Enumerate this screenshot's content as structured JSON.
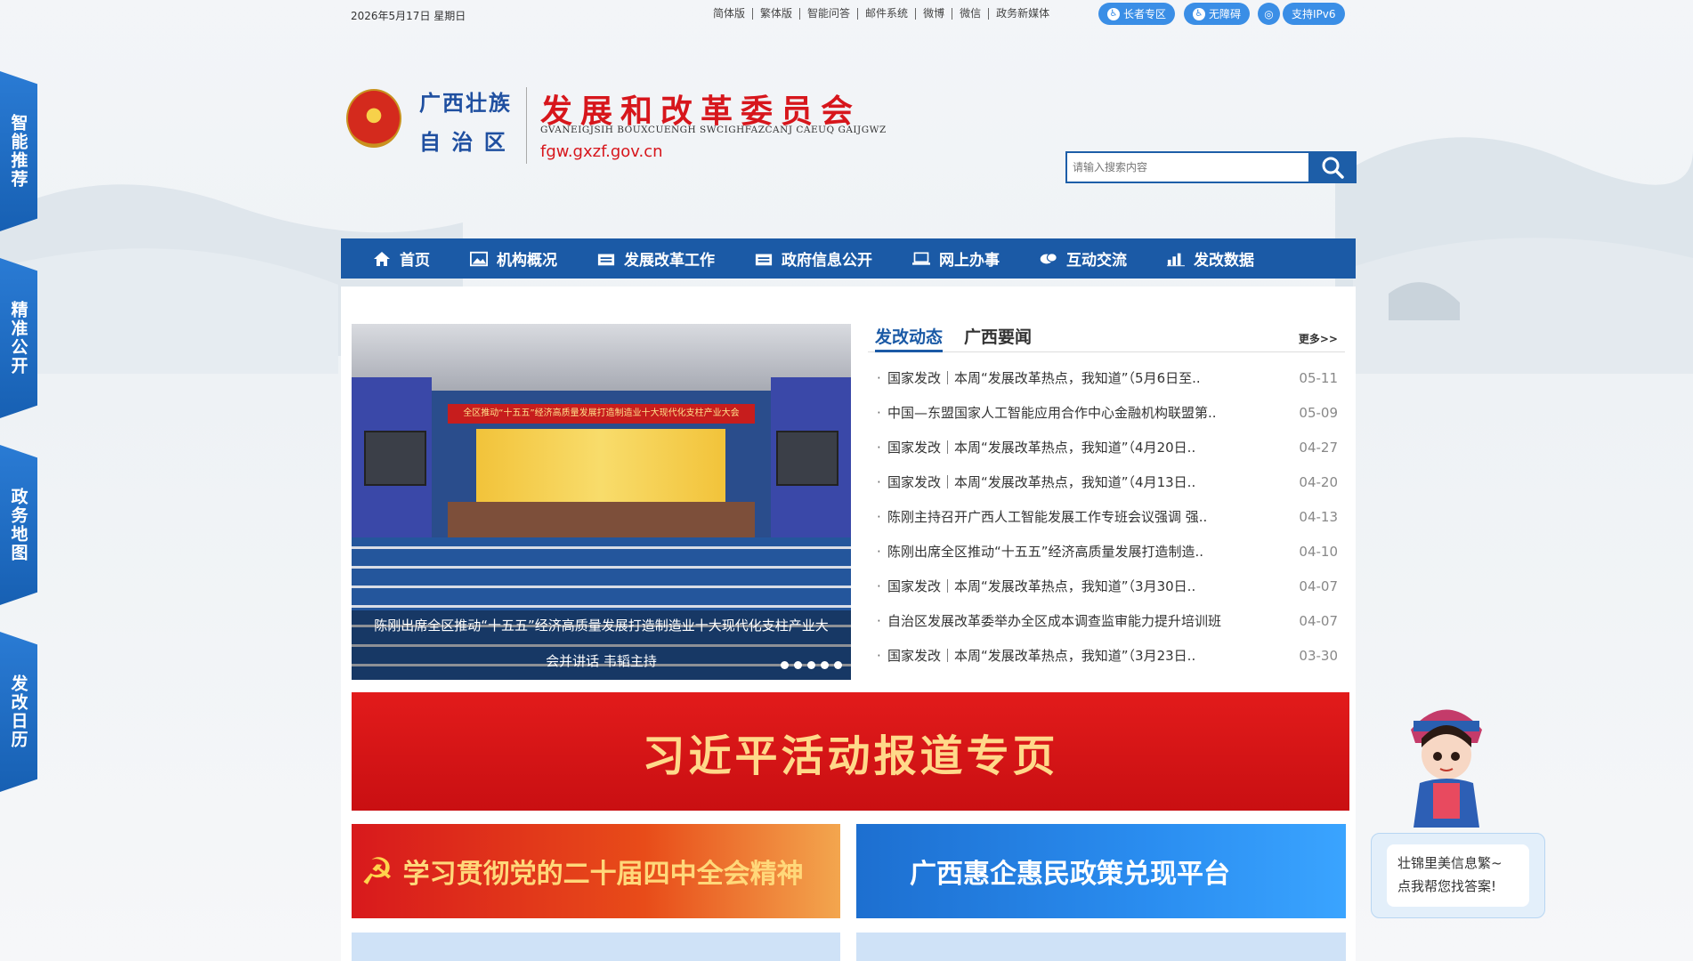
{
  "topbar": {
    "date": "2026年5月17日 星期日",
    "links": [
      "简体版",
      "繁体版",
      "智能问答",
      "邮件系统",
      "微博",
      "微信",
      "政务新媒体"
    ],
    "elder_label": "长者专区",
    "accessible_label": "无障碍",
    "ipv6_label": "支持IPv6"
  },
  "header": {
    "region_line1": "广西壮族",
    "region_line2": "自 治 区",
    "org_name": "发展和改革委员会",
    "org_pinyin": "GVANEIGJSIH BOUXCUENGH SWCIGHFAZCANJ CAEUQ GAIJGWZ",
    "domain": "fgw.gxzf.gov.cn"
  },
  "search": {
    "placeholder": "请输入搜索内容"
  },
  "nav": [
    {
      "label": "首页",
      "icon": "home-icon"
    },
    {
      "label": "机构概况",
      "icon": "picture-icon"
    },
    {
      "label": "发展改革工作",
      "icon": "folder-icon"
    },
    {
      "label": "政府信息公开",
      "icon": "folder-icon"
    },
    {
      "label": "网上办事",
      "icon": "laptop-icon"
    },
    {
      "label": "互动交流",
      "icon": "chat-icon"
    },
    {
      "label": "发改数据",
      "icon": "bar-chart-icon"
    }
  ],
  "slider": {
    "banner_text": "全区推动“十五五”经济高质量发展打造制造业十大现代化支柱产业大会",
    "caption_line1": "陈刚出席全区推动“十五五”经济高质量发展打造制造业十大现代化支柱产业大",
    "caption_line2": "会并讲话 韦韬主持"
  },
  "news_tabs": {
    "active": "发改动态",
    "second": "广西要闻",
    "more": "更多>>"
  },
  "news": [
    {
      "title": "国家发改｜本周“发展改革热点，我知道”（5月6日至..",
      "date": "05-11"
    },
    {
      "title": "中国—东盟国家人工智能应用合作中心金融机构联盟第..",
      "date": "05-09"
    },
    {
      "title": "国家发改｜本周“发展改革热点，我知道”（4月20日..",
      "date": "04-27"
    },
    {
      "title": "国家发改｜本周“发展改革热点，我知道”（4月13日..",
      "date": "04-20"
    },
    {
      "title": "陈刚主持召开广西人工智能发展工作专班会议强调 强..",
      "date": "04-13"
    },
    {
      "title": "陈刚出席全区推动“十五五”经济高质量发展打造制造..",
      "date": "04-10"
    },
    {
      "title": "国家发改｜本周“发展改革热点，我知道”（3月30日..",
      "date": "04-07"
    },
    {
      "title": "自治区发展改革委举办全区成本调查监审能力提升培训班",
      "date": "04-07"
    },
    {
      "title": "国家发改｜本周“发展改革热点，我知道”（3月23日..",
      "date": "03-30"
    }
  ],
  "banners": {
    "xi": "习近平活动报道专页",
    "party": "学习贯彻党的二十届四中全会精神",
    "policy": "广西惠企惠民政策兑现平台"
  },
  "side_tabs": [
    "智能推荐",
    "精准公开",
    "政务地图",
    "发改日历"
  ],
  "assistant": {
    "line1": "壮锦里美信息繁~",
    "line2": "点我帮您找答案!"
  },
  "colors": {
    "primary": "#1b5aa6",
    "red": "#d7161c",
    "accent": "#3a8ee6"
  }
}
